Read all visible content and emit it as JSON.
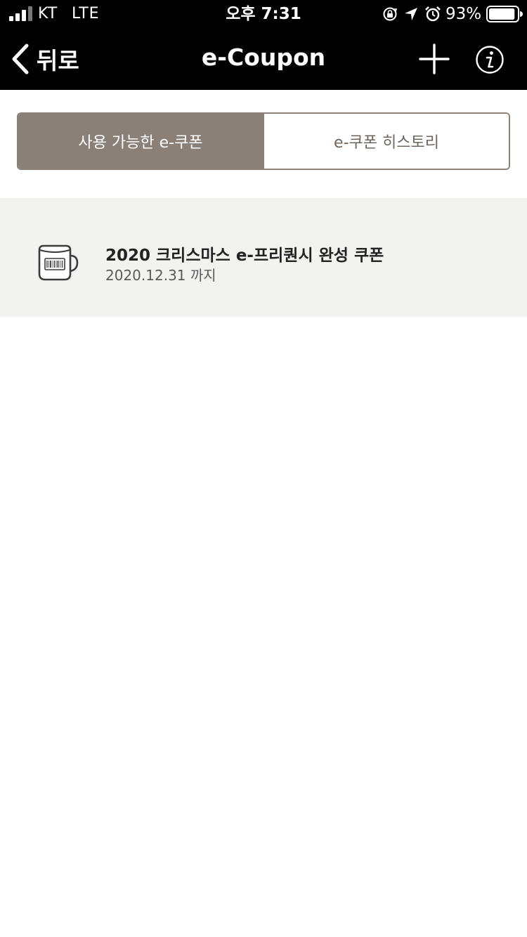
{
  "status_bar": {
    "carrier": "KT",
    "network": "LTE",
    "time": "오후 7:31",
    "battery_percent": "93%",
    "battery_level": 0.93,
    "icons": [
      "signal-icon",
      "orientation-lock-icon",
      "location-arrow-icon",
      "alarm-clock-icon",
      "battery-icon"
    ]
  },
  "nav": {
    "back_label": "뒤로",
    "title": "e-Coupon",
    "icons": [
      "back-chevron-icon",
      "plus-icon",
      "info-icon"
    ]
  },
  "tabs": [
    {
      "label": "사용 가능한 e-쿠폰",
      "active": true
    },
    {
      "label": "e-쿠폰 히스토리",
      "active": false
    }
  ],
  "coupons": [
    {
      "title": "2020 크리스마스 e-프리퀀시 완성 쿠폰",
      "expiry": "2020.12.31 까지",
      "icon": "coupon-mug-icon"
    }
  ],
  "colors": {
    "topbar": "#000000",
    "tab_active_bg": "#8b8078",
    "tab_inactive_text": "#6f655e",
    "list_bg": "#f2f2f1"
  }
}
